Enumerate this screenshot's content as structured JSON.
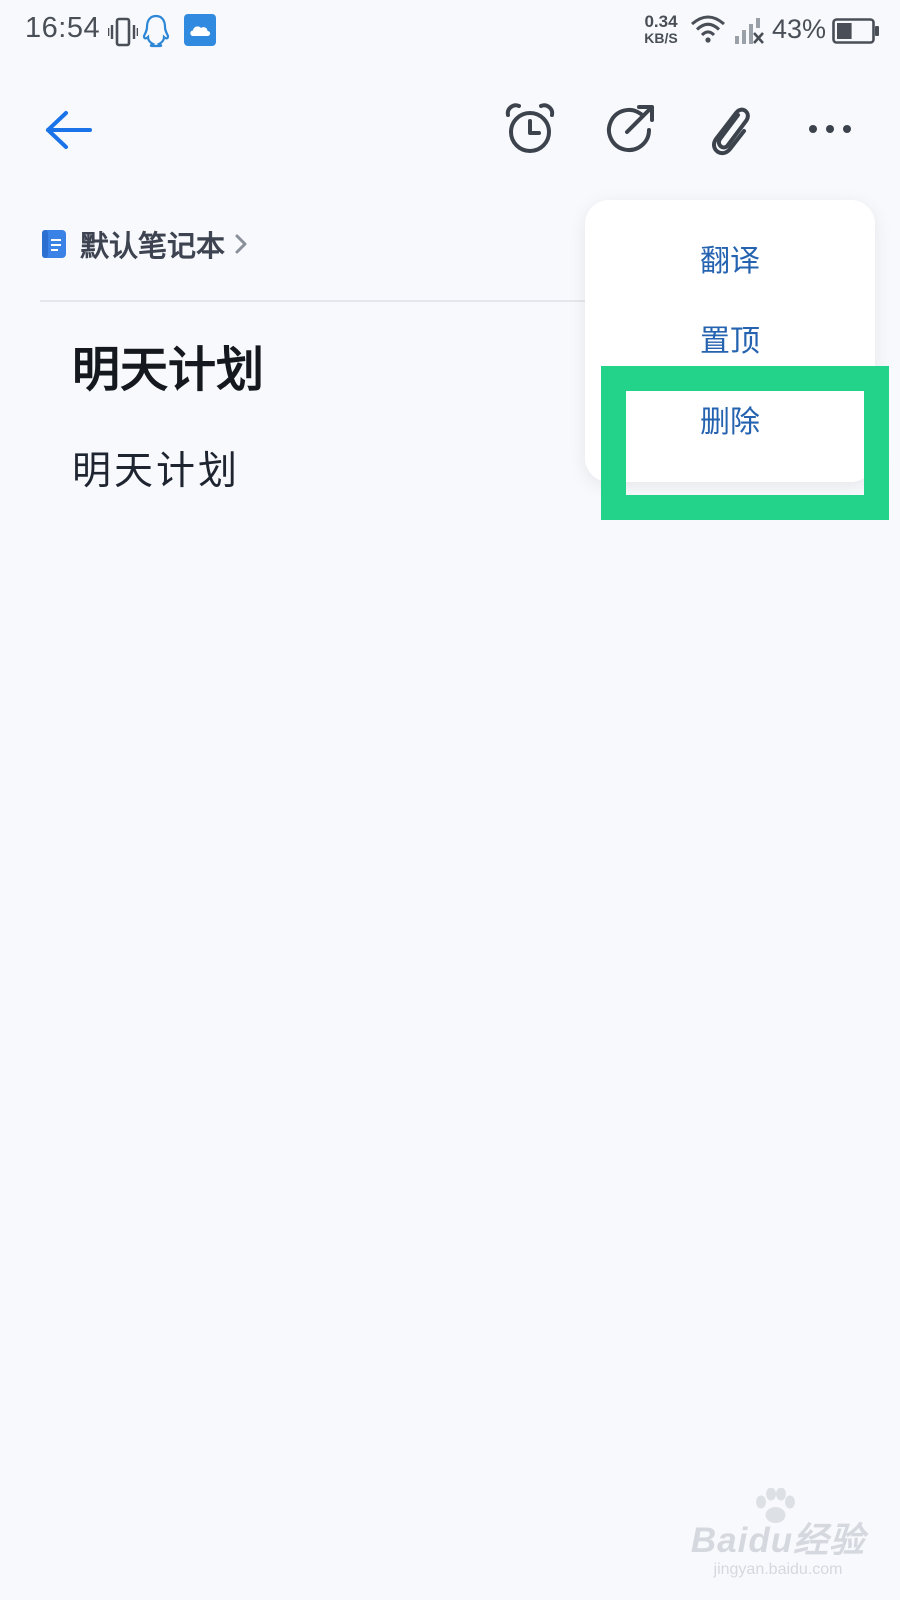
{
  "status_bar": {
    "time": "16:54",
    "net_speed_value": "0.34",
    "net_speed_unit": "KB/S",
    "battery_percent": "43%",
    "battery_level": 0.43,
    "icons": [
      "vibrate-icon",
      "qq-icon",
      "cloud-app-icon",
      "wifi-icon",
      "no-signal-icon",
      "battery-icon"
    ]
  },
  "toolbar": {
    "icons": [
      "back-arrow-icon",
      "alarm-clock-icon",
      "share-icon",
      "attachment-icon",
      "more-icon"
    ]
  },
  "notebook": {
    "name": "默认笔记本"
  },
  "note": {
    "title": "明天计划",
    "body": "明天计划"
  },
  "menu": {
    "items": [
      {
        "label": "翻译"
      },
      {
        "label": "置顶"
      },
      {
        "label": "删除"
      }
    ],
    "highlighted": "删除"
  },
  "watermark": {
    "brand": "Baidu经验",
    "url": "jingyan.baidu.com"
  },
  "colors": {
    "accent": "#1a73e8",
    "menu_text": "#2563b0",
    "highlight": "#23d389",
    "background": "#f7f9fc"
  }
}
